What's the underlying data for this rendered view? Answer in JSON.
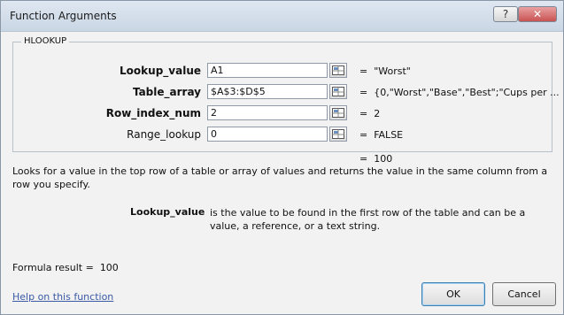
{
  "window": {
    "title": "Function Arguments",
    "help_glyph": "?",
    "close_glyph": "✕"
  },
  "function_name": "HLOOKUP",
  "arguments": [
    {
      "label": "Lookup_value",
      "bold": true,
      "value": "A1",
      "result": "\"Worst\""
    },
    {
      "label": "Table_array",
      "bold": true,
      "value": "$A$3:$D$5",
      "result": "{0,\"Worst\",\"Base\",\"Best\";\"Cups per ..."
    },
    {
      "label": "Row_index_num",
      "bold": true,
      "value": "2",
      "result": "2"
    },
    {
      "label": "Range_lookup",
      "bold": false,
      "value": "0",
      "result": "FALSE"
    }
  ],
  "equals_sign": "=",
  "function_result": "100",
  "description": "Looks for a value in the top row of a table or array of values and returns the value in the same column from a row you specify.",
  "arg_help": {
    "name": "Lookup_value",
    "text": "is the value to be found in the first row of the table and can be a value, a reference, or a text string."
  },
  "formula_result": {
    "label": "Formula result =",
    "value": "100"
  },
  "help_link": "Help on this function",
  "buttons": {
    "ok": "OK",
    "cancel": "Cancel"
  }
}
